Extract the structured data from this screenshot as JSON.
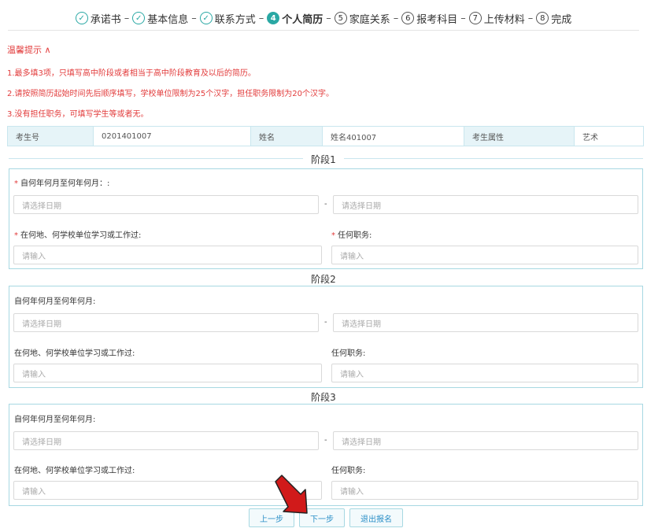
{
  "steps": [
    {
      "label": "承诺书",
      "icon": "✓",
      "state": "done"
    },
    {
      "label": "基本信息",
      "icon": "✓",
      "state": "done"
    },
    {
      "label": "联系方式",
      "icon": "✓",
      "state": "done"
    },
    {
      "label": "个人简历",
      "icon": "4",
      "state": "active"
    },
    {
      "label": "家庭关系",
      "icon": "5",
      "state": "todo"
    },
    {
      "label": "报考科目",
      "icon": "6",
      "state": "todo"
    },
    {
      "label": "上传材料",
      "icon": "7",
      "state": "todo"
    },
    {
      "label": "完成",
      "icon": "8",
      "state": "todo"
    }
  ],
  "step_sep": "–",
  "tips": {
    "title": "温馨提示 ∧",
    "items": [
      "1.最多填3项，只填写高中阶段或者相当于高中阶段教育及以后的简历。",
      "2.请按照简历起始时间先后顺序填写，学校单位限制为25个汉字，担任职务限制为20个汉字。",
      "3.没有担任职务，可填写学生等或者无。"
    ]
  },
  "info": {
    "exam_no_label": "考生号",
    "exam_no": "0201401007",
    "name_label": "姓名",
    "name": "姓名401007",
    "attr_label": "考生属性",
    "attr": "艺术"
  },
  "stages": [
    {
      "title": "阶段1",
      "date_label": "自何年何月至何年何月：:",
      "place_label": "在何地、何学校单位学习或工作过:",
      "position_label": "任何职务:",
      "required": true
    },
    {
      "title": "阶段2",
      "date_label": "自何年何月至何年何月:",
      "place_label": "在何地、何学校单位学习或工作过:",
      "position_label": "任何职务:",
      "required": false
    },
    {
      "title": "阶段3",
      "date_label": "自何年何月至何年何月:",
      "place_label": "在何地、何学校单位学习或工作过:",
      "position_label": "任何职务:",
      "required": false
    }
  ],
  "placeholders": {
    "date": "请选择日期",
    "input": "请输入",
    "range_sep": "-",
    "req_mark": "*"
  },
  "buttons": {
    "prev": "上一步",
    "next": "下一步",
    "quit": "退出报名"
  },
  "colors": {
    "accent": "#2aa8a4",
    "warning": "#e23b3b",
    "arrow": "#d11a1a"
  }
}
